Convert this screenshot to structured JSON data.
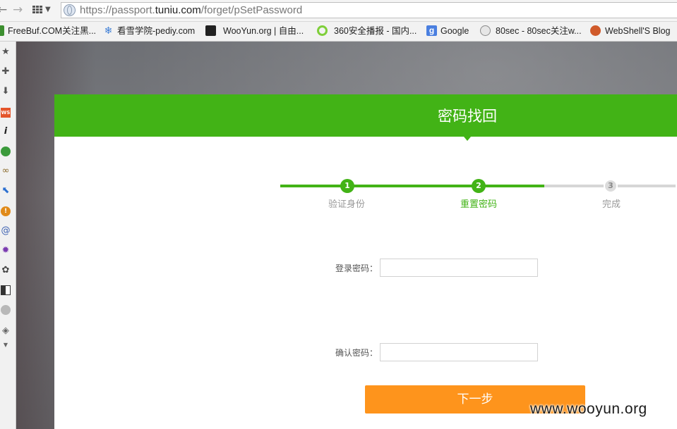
{
  "browser": {
    "url_prefix": "https://passport.",
    "url_domain": "tuniu.com",
    "url_path": "/forget/pSetPassword",
    "bookmarks": [
      {
        "label": "FreeBuf.COM关注黑...",
        "icon": "freebuf-icon",
        "color": "#3c8f2f"
      },
      {
        "label": "看雪学院-pediy.com",
        "icon": "snowflake-icon",
        "color": "#3f7fd6"
      },
      {
        "label": "WooYun.org | 自由...",
        "icon": "wooyun-icon",
        "color": "#222222"
      },
      {
        "label": "360安全播报 - 国内...",
        "icon": "360-icon",
        "color": "#7fcf3a"
      },
      {
        "label": "Google",
        "icon": "google-icon",
        "color": "#4a7fe0"
      },
      {
        "label": "80sec - 80sec关注w...",
        "icon": "globe-icon",
        "color": "#9a9a9a"
      },
      {
        "label": "WebShell'S Blog",
        "icon": "webshell-icon",
        "color": "#d05a2a"
      }
    ]
  },
  "page": {
    "title": "密码找回",
    "steps": [
      {
        "number": "1",
        "label": "验证身份",
        "state": "done"
      },
      {
        "number": "2",
        "label": "重置密码",
        "state": "current"
      },
      {
        "number": "3",
        "label": "完成",
        "state": "todo"
      }
    ],
    "form": {
      "password_label": "登录密码：",
      "password_value": "",
      "confirm_label": "确认密码：",
      "confirm_value": "",
      "next_button": "下一步"
    },
    "colors": {
      "brand_green": "#42b316",
      "button_orange": "#fe941c"
    }
  },
  "watermark": "www.wooyun.org"
}
